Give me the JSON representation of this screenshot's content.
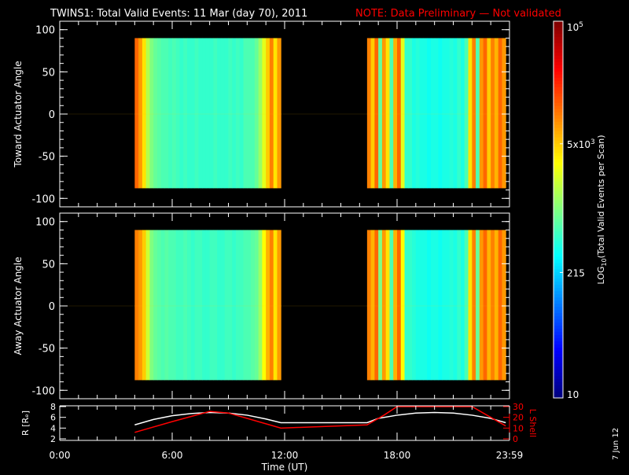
{
  "title": "TWINS1: Total Valid Events: 11 Mar (day  70), 2011",
  "note": "NOTE: Data Preliminary — Not validated",
  "date_stamp": "7 Jun 12",
  "colors": {
    "background": "#000000",
    "axes": "#ffffff",
    "note": "#ff0000",
    "lshell": "#ff0000",
    "radius": "#ffffff"
  },
  "chart_data": [
    {
      "type": "heatmap",
      "ylabel": "Toward Actuator Angle",
      "ylim": [
        -110,
        110
      ],
      "yticks": [
        100,
        50,
        0,
        -50,
        -100
      ],
      "xlim": [
        0,
        24
      ],
      "colorscale": "jet, log10",
      "bin_hours": 0.2,
      "blocks": [
        {
          "start_hour": 4.0,
          "angle_range": [
            -88,
            90
          ],
          "log10_values": [
            4.1,
            3.9,
            3.6,
            3.2,
            3.0,
            2.9,
            2.85,
            2.8,
            2.8,
            2.75,
            2.8,
            2.75,
            2.7,
            2.75,
            2.7,
            2.7,
            2.75,
            2.7,
            2.7,
            2.7,
            2.7,
            2.75,
            2.7,
            2.7,
            2.7,
            2.75,
            2.7,
            2.75,
            2.7,
            2.8,
            2.8,
            2.8,
            2.9,
            3.1,
            3.4,
            3.7,
            4.0,
            3.6,
            3.9
          ]
        },
        {
          "start_hour": 16.4,
          "angle_range": [
            -88,
            90
          ],
          "log10_values": [
            4.0,
            3.7,
            4.1,
            2.9,
            3.9,
            3.6,
            2.8,
            3.8,
            4.1,
            3.4,
            2.7,
            2.7,
            2.6,
            2.65,
            2.6,
            2.6,
            2.55,
            2.6,
            2.6,
            2.55,
            2.6,
            2.6,
            2.65,
            2.6,
            2.7,
            2.6,
            2.8,
            3.6,
            4.0,
            2.8,
            3.9,
            4.1,
            3.7,
            4.0,
            3.8,
            4.1,
            3.9
          ]
        }
      ]
    },
    {
      "type": "heatmap",
      "ylabel": "Away Actuator Angle",
      "ylim": [
        -110,
        110
      ],
      "yticks": [
        100,
        50,
        0,
        -50,
        -100
      ],
      "xlim": [
        0,
        24
      ],
      "colorscale": "jet, log10",
      "bin_hours": 0.2,
      "blocks": [
        {
          "start_hour": 4.0,
          "angle_range": [
            -88,
            90
          ],
          "log10_values": [
            4.0,
            3.9,
            3.7,
            3.3,
            3.0,
            2.9,
            2.85,
            2.8,
            2.85,
            2.8,
            2.8,
            2.75,
            2.75,
            2.8,
            2.75,
            2.7,
            2.75,
            2.75,
            2.7,
            2.7,
            2.75,
            2.75,
            2.7,
            2.7,
            2.75,
            2.75,
            2.7,
            2.75,
            2.75,
            2.8,
            2.8,
            2.85,
            2.9,
            3.1,
            3.5,
            3.8,
            4.0,
            3.6,
            3.9
          ]
        },
        {
          "start_hour": 16.4,
          "angle_range": [
            -88,
            90
          ],
          "log10_values": [
            4.0,
            3.8,
            4.1,
            3.0,
            3.9,
            3.6,
            2.8,
            3.8,
            4.1,
            3.5,
            2.7,
            2.7,
            2.65,
            2.6,
            2.6,
            2.6,
            2.55,
            2.6,
            2.6,
            2.55,
            2.6,
            2.6,
            2.65,
            2.6,
            2.7,
            2.6,
            2.8,
            3.6,
            4.0,
            2.9,
            3.9,
            4.1,
            3.8,
            4.0,
            3.8,
            4.1,
            3.9
          ]
        }
      ]
    },
    {
      "type": "line",
      "xlabel": "Time (UT)",
      "xticks": [
        "0:00",
        "6:00",
        "12:00",
        "18:00",
        "23:59"
      ],
      "xlim": [
        0,
        24
      ],
      "ylabel": "R [Rₑ]",
      "ylim": [
        2,
        8
      ],
      "yticks": [
        2,
        4,
        6,
        8
      ],
      "y2label": "L Shell",
      "y2lim": [
        0,
        30
      ],
      "y2ticks": [
        0,
        10,
        20,
        30
      ],
      "series": [
        {
          "axis": "left",
          "x": [
            4.0,
            5.0,
            6.0,
            7.0,
            8.0,
            9.0,
            10.0,
            11.0,
            11.8,
            14.0,
            16.4,
            17.0,
            18.0,
            19.0,
            20.0,
            21.0,
            22.0,
            23.0,
            23.8
          ],
          "y": [
            4.6,
            5.6,
            6.3,
            6.7,
            6.9,
            6.8,
            6.4,
            5.7,
            5.0,
            5.0,
            5.0,
            5.8,
            6.4,
            6.8,
            6.9,
            6.8,
            6.4,
            5.8,
            5.0
          ]
        },
        {
          "axis": "right",
          "x": [
            4.0,
            6.0,
            8.0,
            9.0,
            10.0,
            11.8,
            16.4,
            17.3,
            18.0,
            22.0,
            23.8
          ],
          "y": [
            6,
            16,
            25.5,
            24,
            19,
            10,
            13,
            22,
            30,
            30,
            12
          ]
        }
      ]
    },
    {
      "type": "colorbar",
      "label": "LOG10(Total Valid Events per Scan)",
      "label_main": "LOG",
      "label_sub": "10",
      "label_rest": "(Total Valid Events per Scan)",
      "range": [
        10,
        100000
      ],
      "ticks": [
        {
          "value": 100000,
          "text": "10",
          "sup": "5"
        },
        {
          "value": 5000,
          "text": "5x10",
          "sup": "3"
        },
        {
          "value": 215,
          "text": "215"
        },
        {
          "value": 10,
          "text": "10"
        }
      ]
    }
  ]
}
